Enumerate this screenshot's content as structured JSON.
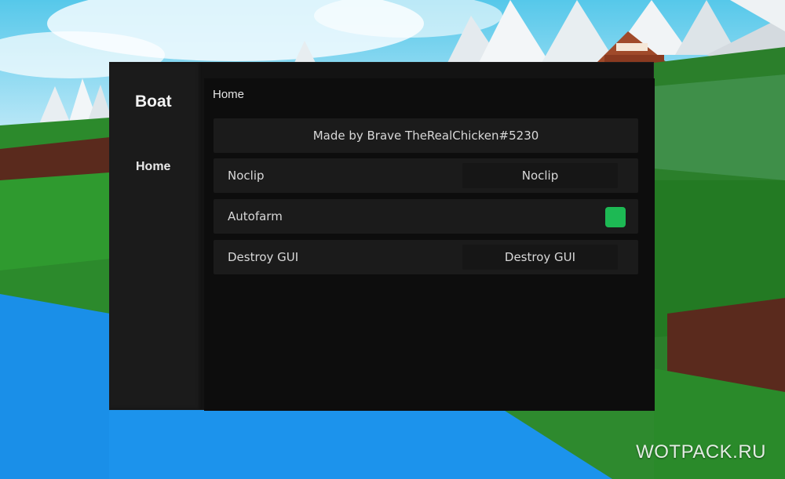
{
  "watermark": "WOTPACK.RU",
  "gui": {
    "brand": "Boat",
    "nav": [
      {
        "label": "Home"
      }
    ],
    "page_title": "Home",
    "credit": "Made by Brave TheRealChicken#5230",
    "rows": [
      {
        "label": "Noclip",
        "button_label": "Noclip"
      },
      {
        "label": "Autofarm",
        "toggle_on": true
      },
      {
        "label": "Destroy GUI",
        "button_label": "Destroy GUI"
      }
    ]
  },
  "colors": {
    "window_bg": "#131313",
    "sidebar_bg": "#1b1b1b",
    "content_bg": "#0d0d0d",
    "row_bg": "#1b1b1b",
    "toggle_on": "#1db954",
    "text": "#d8d8d8"
  }
}
